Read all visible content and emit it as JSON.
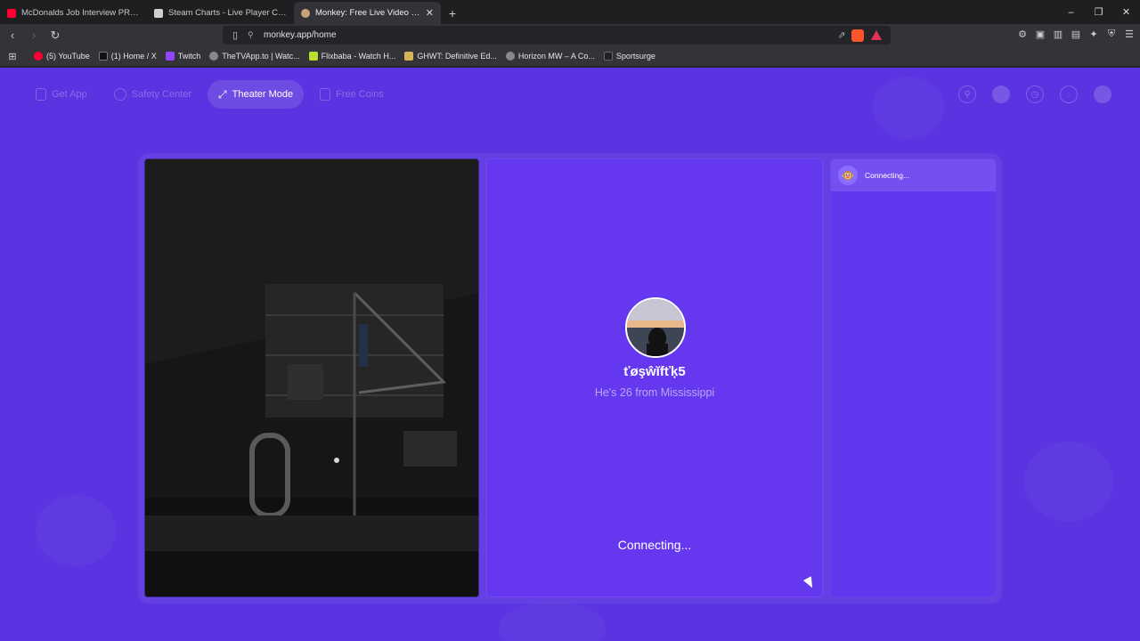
{
  "tabs": [
    {
      "title": "McDonalds Job Interview PRANK - Yo",
      "favicon_color": "#ff0033"
    },
    {
      "title": "Steam Charts - Live Player Count Stati",
      "favicon_color": "#cfcfcf"
    },
    {
      "title": "Monkey: Free Live Video Chat",
      "favicon_color": "#c9a27a"
    }
  ],
  "new_tab_glyph": "+",
  "window_controls": [
    "–",
    "❐",
    "✕"
  ],
  "address": {
    "url": "monkey.app/home"
  },
  "bookmarks": [
    {
      "label": "(5) YouTube",
      "color": "#ff0033"
    },
    {
      "label": "(1) Home / X",
      "color": "#111111"
    },
    {
      "label": "Twitch",
      "color": "#9146ff"
    },
    {
      "label": "TheTVApp.to | Watc...",
      "color": "#888888"
    },
    {
      "label": "Flixbaba - Watch H...",
      "color": "#b6e02c"
    },
    {
      "label": "GHWT: Definitive Ed...",
      "color": "#d7b45a"
    },
    {
      "label": "Horizon MW – A Co...",
      "color": "#888888"
    },
    {
      "label": "Sportsurge",
      "color": "#222222"
    }
  ],
  "nav": {
    "get_app": "Get App",
    "safety_center": "Safety Center",
    "theater_mode": "Theater Mode",
    "free_coins": "Free Coins"
  },
  "remote": {
    "username": "ťøşŵĭfťķ5",
    "info": "He's 26 from Mississippi",
    "status": "Connecting..."
  },
  "chat": {
    "status": "Connecting..."
  },
  "colors": {
    "page_bg": "#5b33e0",
    "panel_bg": "#6538ef",
    "accent": "#ffffff"
  }
}
